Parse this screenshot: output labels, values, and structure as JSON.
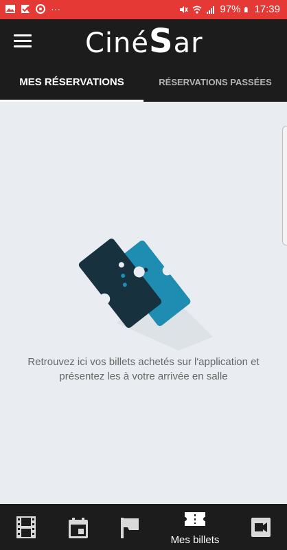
{
  "status_bar": {
    "battery": "97%",
    "time": "17:39",
    "more": "···"
  },
  "app_bar": {
    "logo_prefix": "Ciné",
    "logo_s": "S",
    "logo_suffix": "ar"
  },
  "tabs": [
    {
      "label": "MES RÉSERVATIONS",
      "active": true
    },
    {
      "label": "RÉSERVATIONS PASSÉES",
      "active": false
    }
  ],
  "empty_state": {
    "line1": "Retrouvez ici vos billets achetés sur l'application et",
    "line2": "présentez les à votre arrivée en salle"
  },
  "bottom_nav": [
    {
      "icon": "film-icon",
      "label": ""
    },
    {
      "icon": "calendar-icon",
      "label": ""
    },
    {
      "icon": "flag-icon",
      "label": ""
    },
    {
      "icon": "ticket-icon",
      "label": "Mes billets",
      "active": true
    },
    {
      "icon": "video-camera-icon",
      "label": ""
    }
  ],
  "colors": {
    "status_bar": "#e53935",
    "app_bar": "#1c1c1c",
    "background": "#e9edf1",
    "ticket_dark": "#17313f",
    "ticket_blue": "#1f8cb2"
  }
}
